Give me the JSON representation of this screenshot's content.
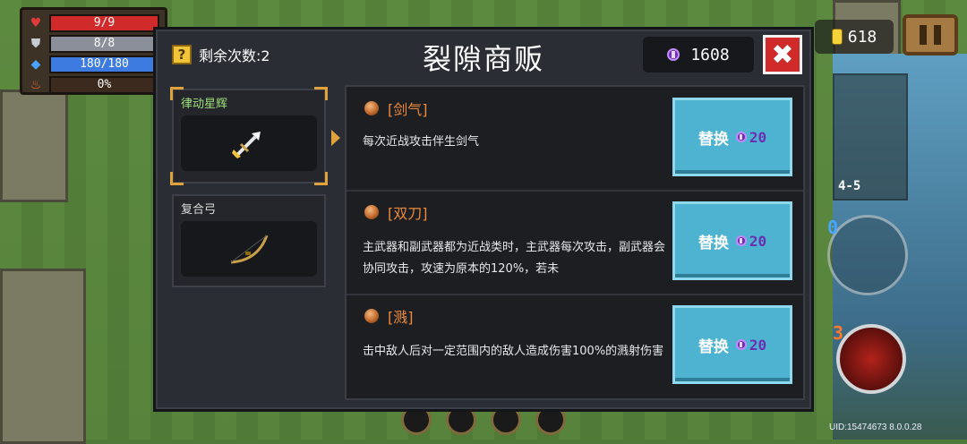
{
  "hud": {
    "hp": {
      "text": "9/9",
      "fraction": 1.0,
      "color": "#d12a2a"
    },
    "armor": {
      "text": "8/8",
      "fraction": 1.0,
      "color": "#8a8f99"
    },
    "energy": {
      "text": "180/180",
      "fraction": 1.0,
      "color": "#3d7be0"
    },
    "crit": {
      "text": "0%",
      "fraction": 0.0,
      "color": "#c26a2a"
    }
  },
  "top_right": {
    "coins": "618",
    "level": "4-5",
    "ammo": "0",
    "skill_count": "3"
  },
  "shop": {
    "title": "裂隙商贩",
    "remaining_label": "剩余次数:2",
    "remaining_icon": "?",
    "gems": "1608",
    "close_label": "✖",
    "weapons": [
      {
        "name": "律动星辉",
        "selected": true,
        "icon": "crossbow-icon"
      },
      {
        "name": "复合弓",
        "selected": false,
        "icon": "bow-icon"
      }
    ],
    "perks": [
      {
        "name": "[剑气]",
        "desc": "每次近战攻击伴生剑气",
        "button": "替换",
        "cost": "20"
      },
      {
        "name": "[双刀]",
        "desc": "主武器和副武器都为近战类时，主武器每次攻击，副武器会协同攻击，攻速为原本的120%，若未",
        "button": "替换",
        "cost": "20"
      },
      {
        "name": "[溅]",
        "desc": "击中敌人后对一定范围内的敌人造成伤害100%的溅射伤害",
        "button": "替换",
        "cost": "20"
      }
    ]
  },
  "uid": "UID:15474673 8.0.0.28"
}
